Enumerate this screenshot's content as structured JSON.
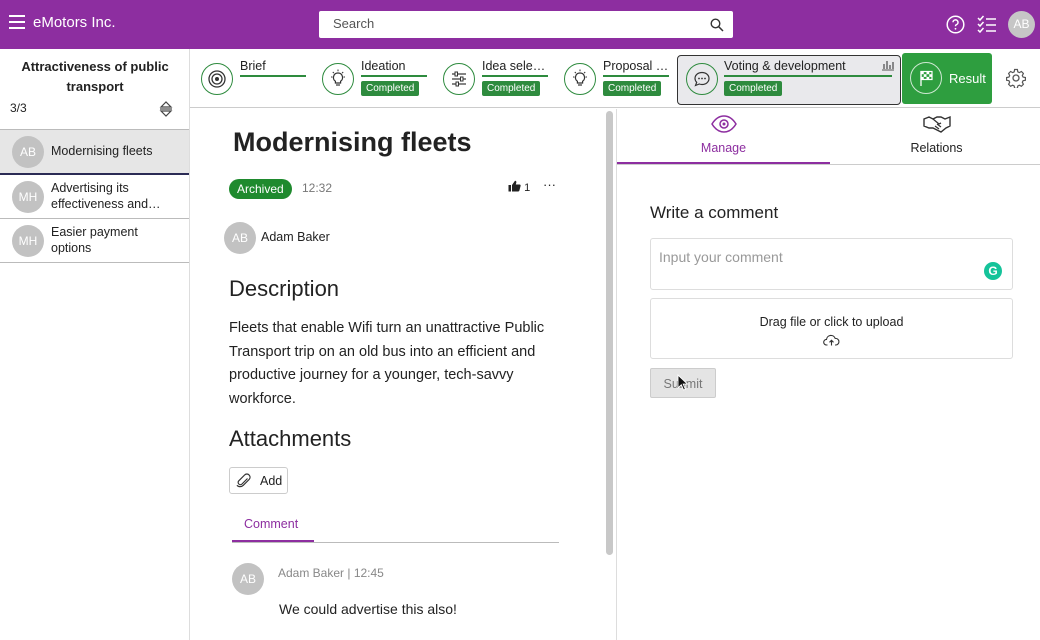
{
  "header": {
    "company": "eMotors Inc.",
    "search_placeholder": "Search",
    "avatar_initials": "AB",
    "brand_color": "#8d2ea0"
  },
  "sidebar": {
    "title": "Attractiveness of public transport",
    "count": "3/3",
    "items": [
      {
        "initials": "AB",
        "label": "Modernising fleets",
        "active": true
      },
      {
        "initials": "MH",
        "label": "Advertising its effectiveness and…"
      },
      {
        "initials": "MH",
        "label": "Easier payment options"
      }
    ]
  },
  "phases": [
    {
      "name": "Brief",
      "icon": "target-icon",
      "status": ""
    },
    {
      "name": "Ideation",
      "icon": "lightbulb-icon",
      "status": "Completed"
    },
    {
      "name": "Idea sele…",
      "icon": "sliders-icon",
      "status": "Completed"
    },
    {
      "name": "Proposal …",
      "icon": "lightbulb-icon",
      "status": "Completed"
    },
    {
      "name": "Voting & development",
      "icon": "chat-icon",
      "status": "Completed",
      "current": true
    },
    {
      "name": "Result",
      "icon": "flag-icon"
    }
  ],
  "idea": {
    "title": "Modernising fleets",
    "status": "Archived",
    "time": "12:32",
    "likes": "1",
    "more": "···",
    "author_initials": "AB",
    "author": "Adam Baker",
    "description_heading": "Description",
    "description": "Fleets that enable Wifi turn an unattractive Public Transport trip on an old bus into an efficient and productive journey for a younger, tech-savvy workforce.",
    "attachments_heading": "Attachments",
    "add_label": "Add",
    "comment_tab": "Comment"
  },
  "comments": [
    {
      "initials": "AB",
      "meta": "Adam Baker | 12:45",
      "text": "We could advertise this also!"
    }
  ],
  "right_panel": {
    "tabs": [
      {
        "label": "Manage",
        "icon": "eye-icon",
        "active": true
      },
      {
        "label": "Relations",
        "icon": "handshake-icon"
      }
    ],
    "write_heading": "Write a comment",
    "input_placeholder": "Input your comment",
    "grammarly_letter": "G",
    "upload_text": "Drag file or click to upload",
    "submit_label": "Submit"
  },
  "colors": {
    "accent": "#8d2ea0",
    "success": "#2e8b3e",
    "archived": "#1f8a2e"
  }
}
